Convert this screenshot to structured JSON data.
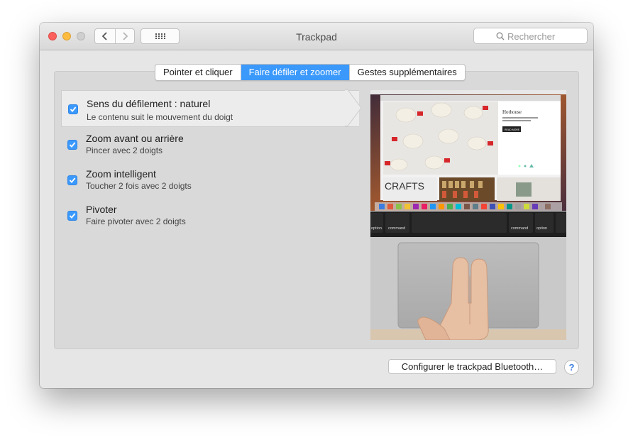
{
  "window": {
    "title": "Trackpad"
  },
  "toolbar": {
    "search_placeholder": "Rechercher"
  },
  "tabs": [
    {
      "label": "Pointer et cliquer",
      "active": false
    },
    {
      "label": "Faire défiler et zoomer",
      "active": true
    },
    {
      "label": "Gestes supplémentaires",
      "active": false
    }
  ],
  "options": [
    {
      "title": "Sens du défilement : naturel",
      "subtitle": "Le contenu suit le mouvement du doigt",
      "checked": true,
      "selected": true
    },
    {
      "title": "Zoom avant ou arrière",
      "subtitle": "Pincer avec 2 doigts",
      "checked": true,
      "selected": false
    },
    {
      "title": "Zoom intelligent",
      "subtitle": "Toucher 2 fois avec 2 doigts",
      "checked": true,
      "selected": false
    },
    {
      "title": "Pivoter",
      "subtitle": "Faire pivoter avec 2 doigts",
      "checked": true,
      "selected": false
    }
  ],
  "preview": {
    "site_title": "Hothouse",
    "button_label": "READ MORE",
    "crafts_label": "CRAFTS",
    "keys": [
      "option",
      "command",
      "command",
      "option"
    ]
  },
  "footer": {
    "configure_label": "Configurer le trackpad Bluetooth…",
    "help_label": "?"
  },
  "colors": {
    "accent": "#3b99fc",
    "close": "#fc605c",
    "minimize": "#fdbc40"
  }
}
